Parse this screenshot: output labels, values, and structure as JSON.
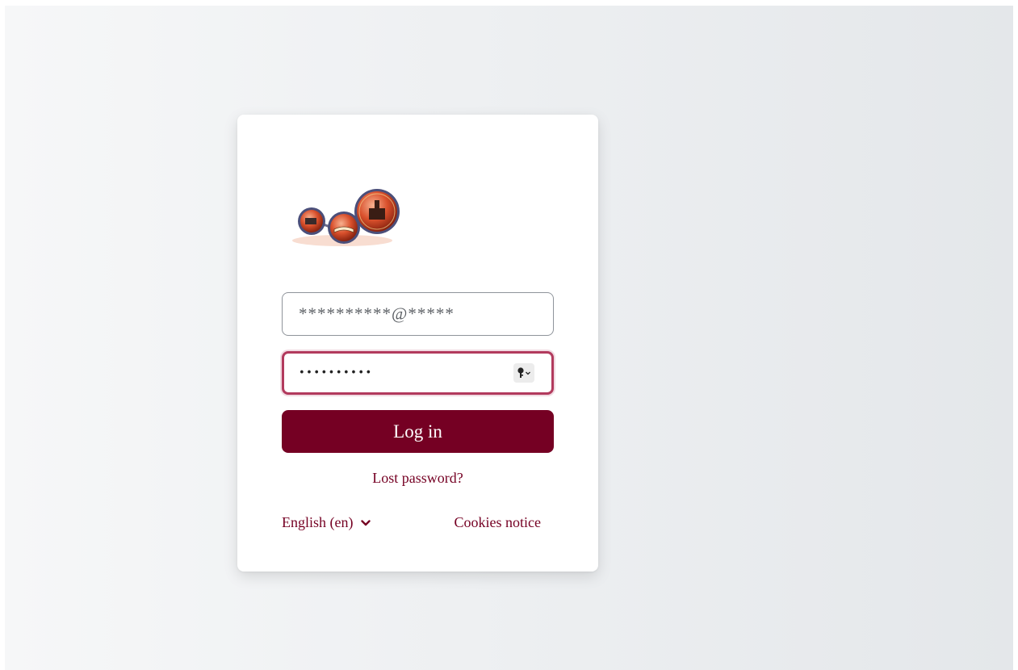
{
  "login": {
    "username_value": "**********@*****",
    "password_value": "••••••••••",
    "login_button": "Log in",
    "lost_password": "Lost password?",
    "language": "English (en)",
    "cookies": "Cookies notice"
  },
  "icons": {
    "logo": "site-logo",
    "password_manager": "key-icon",
    "language_chevron": "chevron-down-icon"
  },
  "colors": {
    "accent": "#750023",
    "focus_border": "#b23a5d"
  }
}
